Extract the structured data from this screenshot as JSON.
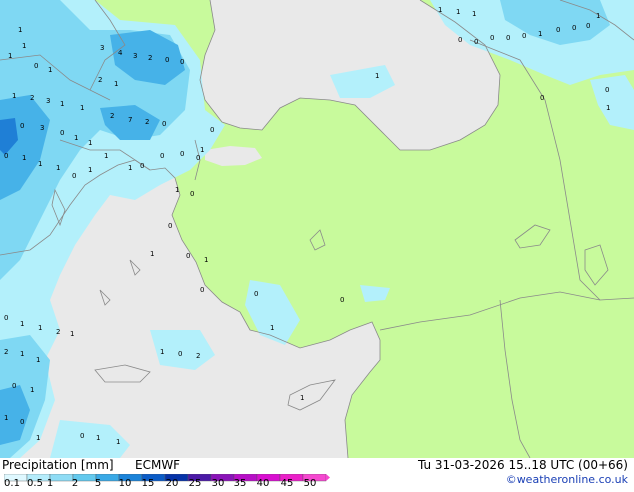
{
  "footer": {
    "title": "Precipitation [mm]",
    "model": "ECMWF",
    "validity": "Tu 31-03-2026 15..18 UTC (00+66)",
    "credit": "©weatheronline.co.uk"
  },
  "legend": {
    "labels": [
      "0.1",
      "0.5",
      "1",
      "2",
      "5",
      "10",
      "15",
      "20",
      "25",
      "30",
      "35",
      "40",
      "45",
      "50"
    ],
    "colors": [
      "#dff8ff",
      "#b5ecfb",
      "#8fdcf5",
      "#63c9ee",
      "#3aa9e6",
      "#1b83d9",
      "#0b5cc7",
      "#0633a8",
      "#4b1aa6",
      "#8a14b8",
      "#b70fc7",
      "#d80fd0",
      "#ea20c8",
      "#f548d0"
    ]
  },
  "colors": {
    "land": "#c8fa9c",
    "sea": "#e9e9e9",
    "border": "#8a8a8a",
    "precip_light": "#b3f0fb",
    "precip_mid": "#7fd8f3",
    "precip_heavy": "#46b2e8",
    "precip_peak": "#1f7fd6"
  },
  "map": {
    "values": [
      "1",
      "1",
      "1",
      "0",
      "1",
      "3",
      "4",
      "3",
      "2",
      "0",
      "0",
      "1",
      "2",
      "3",
      "1",
      "1",
      "2",
      "1",
      "0",
      "3",
      "0",
      "1",
      "1",
      "2",
      "7",
      "2",
      "0",
      "0",
      "1",
      "1",
      "1",
      "0",
      "1",
      "1",
      "1",
      "0",
      "0",
      "0",
      "0",
      "0",
      "1",
      "1",
      "0",
      "0",
      "0",
      "1",
      "1",
      "0",
      "0",
      "1",
      "0",
      "1",
      "0",
      "1",
      "1",
      "2",
      "1",
      "2",
      "1",
      "1",
      "1",
      "0",
      "2",
      "0",
      "1",
      "1",
      "0",
      "1",
      "0",
      "1",
      "1",
      "1",
      "1",
      "1",
      "1",
      "0",
      "0",
      "0",
      "0",
      "0",
      "1",
      "0",
      "0",
      "0",
      "0",
      "0",
      "1",
      "1"
    ]
  }
}
